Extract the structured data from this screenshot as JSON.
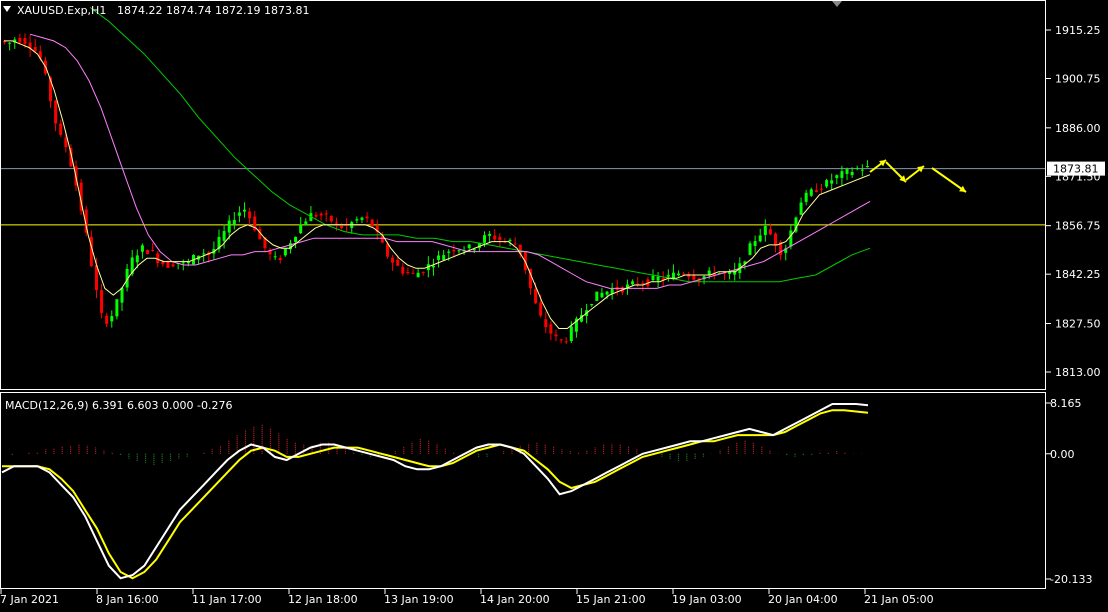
{
  "header": {
    "symbol_label": "XAUUSD.Exp,H1",
    "ohlc": "1874.22 1874.74 1872.19 1873.81"
  },
  "price_axis": {
    "ticks": [
      "1915.25",
      "1900.75",
      "1886.00",
      "1871.50",
      "1856.75",
      "1842.25",
      "1827.50",
      "1813.00"
    ],
    "current_price": "1873.81"
  },
  "macd": {
    "label": "MACD(12,26,9) 6.391 6.603 0.000 -0.276",
    "axis_ticks": [
      "8.165",
      "0.00",
      "-20.133"
    ]
  },
  "time_axis": {
    "labels": [
      "7 Jan 2021",
      "8 Jan 16:00",
      "11 Jan 17:00",
      "12 Jan 18:00",
      "13 Jan 19:00",
      "14 Jan 20:00",
      "15 Jan 21:00",
      "19 Jan 03:00",
      "20 Jan 04:00",
      "21 Jan 05:00"
    ]
  },
  "colors": {
    "background": "#000000",
    "bull_candle": "#00ff00",
    "bear_candle": "#ff0000",
    "ma_fast": "#ffff99",
    "ma_mid": "#ff80ff",
    "ma_slow": "#00cc00",
    "macd_line": "#ffffff",
    "signal_line": "#ffff00",
    "hist_pos": "#cc2222",
    "hist_neg": "#228822",
    "support_line": "#ffff00",
    "price_line": "#8899aa",
    "forecast_arrow": "#ffff00"
  },
  "chart_data": [
    {
      "type": "candlestick",
      "title": "XAUUSD.Exp,H1",
      "ylim": [
        1810,
        1925
      ],
      "key_levels": {
        "support": 1857.0,
        "last_price": 1873.81
      },
      "x_dates": [
        "7 Jan 2021",
        "8 Jan 16:00",
        "11 Jan 17:00",
        "12 Jan 18:00",
        "13 Jan 19:00",
        "14 Jan 20:00",
        "15 Jan 21:00",
        "19 Jan 03:00",
        "20 Jan 04:00",
        "21 Jan 05:00"
      ],
      "price_path": [
        1912,
        1911,
        1913,
        1912,
        1910,
        1906,
        1895,
        1884,
        1880,
        1870,
        1858,
        1844,
        1830,
        1828,
        1834,
        1842,
        1848,
        1850,
        1849,
        1846,
        1845,
        1846,
        1845,
        1847,
        1849,
        1848,
        1852,
        1856,
        1860,
        1862,
        1858,
        1852,
        1848,
        1846,
        1850,
        1854,
        1858,
        1860,
        1860,
        1859,
        1857,
        1856,
        1858,
        1859,
        1858,
        1853,
        1848,
        1845,
        1843,
        1842,
        1843,
        1845,
        1847,
        1849,
        1850,
        1850,
        1850,
        1852,
        1854,
        1853,
        1852,
        1852,
        1848,
        1838,
        1830,
        1826,
        1823,
        1822,
        1826,
        1830,
        1834,
        1836,
        1837,
        1838,
        1838,
        1839,
        1840,
        1840,
        1841,
        1841,
        1842,
        1843,
        1842,
        1841,
        1842,
        1843,
        1842,
        1842,
        1845,
        1850,
        1854,
        1856,
        1852,
        1848,
        1856,
        1864,
        1866,
        1868,
        1869,
        1871,
        1872,
        1873,
        1874,
        1874
      ],
      "ma_fast": [
        1912,
        1912,
        1911,
        1910,
        1908,
        1904,
        1897,
        1888,
        1878,
        1866,
        1854,
        1845,
        1838,
        1836,
        1838,
        1842,
        1845,
        1847,
        1847,
        1846,
        1846,
        1846,
        1846,
        1847,
        1848,
        1849,
        1851,
        1854,
        1856,
        1857,
        1856,
        1853,
        1851,
        1850,
        1850,
        1852,
        1854,
        1856,
        1857,
        1857,
        1857,
        1857,
        1857,
        1857,
        1856,
        1854,
        1850,
        1847,
        1845,
        1844,
        1844,
        1845,
        1846,
        1847,
        1848,
        1849,
        1850,
        1851,
        1852,
        1852,
        1852,
        1850,
        1846,
        1840,
        1834,
        1829,
        1826,
        1826,
        1828,
        1830,
        1832,
        1834,
        1836,
        1837,
        1838,
        1839,
        1839,
        1840,
        1840,
        1841,
        1841,
        1842,
        1842,
        1842,
        1842,
        1843,
        1843,
        1843,
        1845,
        1847,
        1850,
        1851,
        1851,
        1852,
        1855,
        1860,
        1863,
        1866,
        1867,
        1868,
        1869,
        1870,
        1871,
        1872
      ],
      "ma_mid": [
        1914,
        1913,
        1912,
        1910,
        1906,
        1900,
        1892,
        1882,
        1872,
        1862,
        1854,
        1849,
        1846,
        1845,
        1845,
        1846,
        1847,
        1848,
        1848,
        1849,
        1849,
        1850,
        1851,
        1852,
        1853,
        1853,
        1853,
        1853,
        1853,
        1853,
        1853,
        1852,
        1852,
        1852,
        1852,
        1851,
        1850,
        1849,
        1849,
        1849,
        1849,
        1849,
        1849,
        1848,
        1846,
        1844,
        1842,
        1840,
        1839,
        1838,
        1838,
        1838,
        1838,
        1838,
        1839,
        1839,
        1840,
        1841,
        1842,
        1843,
        1844,
        1845,
        1846,
        1848,
        1850,
        1852,
        1854,
        1856,
        1858,
        1860,
        1862,
        1864
      ],
      "ma_slow": [
        1922,
        1918,
        1913,
        1908,
        1902,
        1896,
        1889,
        1883,
        1877,
        1872,
        1867,
        1863,
        1860,
        1857,
        1855,
        1854,
        1854,
        1854,
        1853,
        1853,
        1852,
        1852,
        1851,
        1850,
        1849,
        1848,
        1847,
        1846,
        1845,
        1844,
        1843,
        1842,
        1841,
        1840,
        1840,
        1840,
        1840,
        1840,
        1840,
        1841,
        1842,
        1845,
        1848,
        1850
      ]
    },
    {
      "type": "macd",
      "title": "MACD(12,26,9)",
      "ylim": [
        -20.133,
        8.165
      ],
      "values": {
        "macd": 6.391,
        "signal": 6.603,
        "third": 0.0,
        "fourth": -0.276
      },
      "macd_line": [
        -3,
        -2,
        -2,
        -2,
        -3,
        -5,
        -7,
        -10,
        -14,
        -18,
        -20,
        -19.5,
        -18,
        -15,
        -12,
        -9,
        -7,
        -5,
        -3,
        -1,
        0.5,
        1.5,
        1,
        -0.5,
        -1,
        0,
        1,
        1.5,
        1.5,
        1,
        0.5,
        0,
        -0.5,
        -1,
        -2,
        -2.5,
        -2.5,
        -2,
        -1,
        0,
        1,
        1.5,
        1.5,
        1,
        0,
        -2,
        -4,
        -6.5,
        -6,
        -5,
        -4,
        -3,
        -2,
        -1,
        0,
        0.5,
        1,
        1.5,
        2,
        2,
        2.5,
        3,
        3.5,
        4,
        3.5,
        3,
        4,
        5,
        6,
        7,
        8,
        8,
        8,
        7.8
      ],
      "signal_line": [
        -2,
        -2,
        -2,
        -2,
        -2.5,
        -4,
        -6,
        -9,
        -12,
        -16,
        -19,
        -20,
        -19,
        -17,
        -14,
        -11,
        -9,
        -7,
        -5,
        -3,
        -1,
        0.5,
        1,
        0.5,
        -0.5,
        -0.5,
        0,
        0.5,
        1,
        1,
        1,
        0.5,
        0,
        -0.5,
        -1,
        -1.5,
        -2,
        -2,
        -1.5,
        -0.5,
        0.5,
        1,
        1.5,
        1,
        0.5,
        -1,
        -2.5,
        -4.5,
        -5.5,
        -5,
        -4.5,
        -3.5,
        -2.5,
        -1.5,
        -0.5,
        0,
        0.5,
        1,
        1.5,
        2,
        2,
        2.5,
        3,
        3,
        3,
        3,
        3.5,
        4.5,
        5.5,
        6.5,
        7,
        7,
        6.8,
        6.6
      ],
      "histogram": [
        0,
        -0.1,
        0,
        0.1,
        0.2,
        0.5,
        0.6,
        0.8,
        0.9,
        1,
        0.9,
        0.7,
        0.4,
        0.1,
        -0.2,
        -0.5,
        -0.8,
        -1,
        -1.2,
        -1,
        -0.8,
        -0.5,
        -0.3,
        0,
        0.2,
        0.5,
        0.9,
        1.4,
        2.0,
        2.6,
        3.0,
        3.1,
        2.8,
        2.2,
        1.6,
        1.2,
        1.0,
        0.9,
        1.2,
        1.3,
        1.0,
        0.6,
        0.2,
        -0.2,
        -0.4,
        -0.3,
        -0.1,
        0.3,
        0.8,
        1.3,
        1.6,
        1.5,
        1.1,
        0.6,
        0.2,
        0,
        -0.2,
        -0.4,
        -0.3,
        0,
        0.3,
        0.6,
        0.9,
        1.1,
        1.2,
        1.0,
        0.8,
        0.5,
        0.3,
        0.2,
        0.4,
        0.7,
        1.0,
        1.1,
        1.0,
        0.8,
        0.5,
        0.2,
        0,
        -0.3,
        -0.6,
        -0.9,
        -0.8,
        -0.6,
        -0.3,
        0,
        0.4,
        0.8,
        1.2,
        1.4,
        1.2,
        0.8,
        0.4,
        0,
        -0.2,
        -0.3,
        -0.2,
        -0.1,
        0.1,
        0.2,
        0.3,
        0.2,
        0,
        0
      ]
    }
  ]
}
